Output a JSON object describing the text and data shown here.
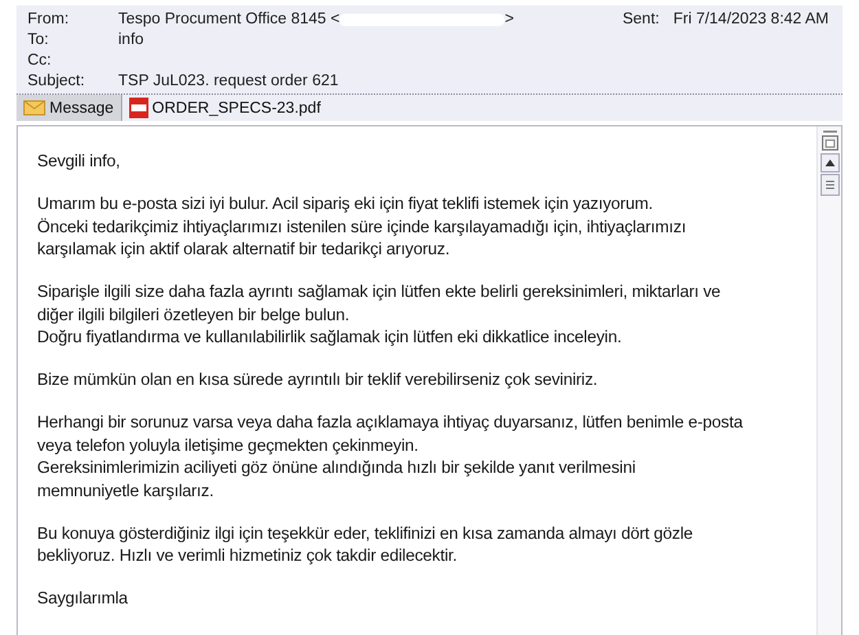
{
  "header": {
    "fields": [
      {
        "label": "From:",
        "value": "Tespo Procument Office 8145 <",
        "redacted": true,
        "value_end": ">"
      },
      {
        "label": "To:",
        "value": "info"
      },
      {
        "label": "Cc:"
      },
      {
        "label": "Subject:",
        "value": "TSP JuL023. request order 621"
      }
    ],
    "sent": {
      "label": "Sent:",
      "value": "Fri 7/14/2023 8:42 AM"
    }
  },
  "tabs": [
    {
      "kind": "message",
      "label": "Message",
      "selected": true
    },
    {
      "kind": "pdf",
      "label": "ORDER_SPECS-23.pdf",
      "selected": false
    }
  ],
  "body": {
    "paragraphs": [
      [
        "Sevgili info,"
      ],
      [
        "Umarım bu e-posta sizi iyi bulur. Acil sipariş eki için fiyat teklifi istemek için yazıyorum.",
        "Önceki tedarikçimiz ihtiyaçlarımızı istenilen süre içinde karşılayamadığı için, ihtiyaçlarımızı",
        "karşılamak için aktif olarak alternatif bir tedarikçi arıyoruz."
      ],
      [
        "Siparişle ilgili size daha fazla ayrıntı sağlamak için lütfen ekte belirli gereksinimleri, miktarları ve",
        "diğer ilgili bilgileri özetleyen bir belge bulun.",
        "Doğru fiyatlandırma ve kullanılabilirlik sağlamak için lütfen eki dikkatlice inceleyin."
      ],
      [
        "Bize mümkün olan en kısa sürede ayrıntılı bir teklif verebilirseniz çok seviniriz."
      ],
      [
        "Herhangi bir sorunuz varsa veya daha fazla açıklamaya ihtiyaç duyarsanız, lütfen benimle e-posta",
        "veya telefon yoluyla iletişime geçmekten çekinmeyin.",
        "Gereksinimlerimizin aciliyeti göz önüne alındığında hızlı bir şekilde yanıt verilmesini",
        "memnuniyetle karşılarız."
      ],
      [
        "Bu konuya gösterdiğiniz ilgi için teşekkür eder, teklifinizi en kısa zamanda almayı dört gözle",
        "bekliyoruz. Hızlı ve verimli hizmetiniz çok takdir edilecektir."
      ],
      [
        "Saygılarımla"
      ]
    ]
  }
}
